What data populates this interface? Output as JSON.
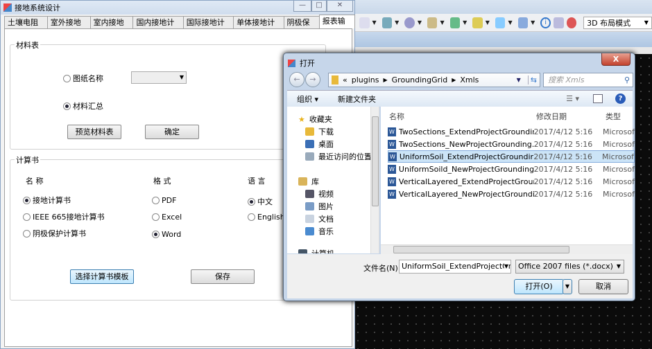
{
  "main": {
    "title": "接地系统设计",
    "tabs": [
      "土壤电阻率",
      "室外接地网",
      "室内接地网",
      "国内接地计算",
      "国际接地计算",
      "单体接地计算",
      "阴极保护",
      "报表输出"
    ],
    "materials": {
      "legend": "材料表",
      "drawing_name_label": "图纸名称",
      "drawing_name_value": "",
      "summary_label": "材料汇总",
      "preview_button": "预览材料表",
      "confirm_button": "确定"
    },
    "calc": {
      "legend": "计算书",
      "name_header": "名  称",
      "format_header": "格  式",
      "language_header": "语  言",
      "names": [
        {
          "label": "接地计算书",
          "checked": true
        },
        {
          "label": "IEEE 665接地计算书",
          "checked": false
        },
        {
          "label": "阴极保护计算书",
          "checked": false
        }
      ],
      "formats": [
        {
          "label": "PDF",
          "checked": false
        },
        {
          "label": "Excel",
          "checked": false
        },
        {
          "label": "Word",
          "checked": true
        }
      ],
      "languages": [
        {
          "label": "中文",
          "checked": true
        },
        {
          "label": "English",
          "checked": false
        }
      ],
      "template_button": "选择计算书模板",
      "save_button": "保存"
    }
  },
  "toolbar": {
    "layout_mode": "3D 布局模式"
  },
  "dialog": {
    "title": "打开",
    "close": "X",
    "path": [
      "«",
      "plugins",
      "GroundingGrid",
      "Xmls"
    ],
    "search_placeholder": "搜索 Xmls",
    "organize": "组织 ▾",
    "new_folder": "新建文件夹",
    "nav": [
      "收藏夹",
      "下载",
      "桌面",
      "最近访问的位置",
      "库",
      "视频",
      "图片",
      "文档",
      "音乐",
      "计算机"
    ],
    "columns": [
      "名称",
      "修改日期",
      "类型"
    ],
    "files": [
      {
        "name": "TwoSections_ExtendProjectGroundin...",
        "date": "2017/4/12 5:16",
        "type": "Microsof"
      },
      {
        "name": "TwoSections_NewProjectGrounding...",
        "date": "2017/4/12 5:16",
        "type": "Microsof"
      },
      {
        "name": "UniformSoil_ExtendProjectGroundin...",
        "date": "2017/4/12 5:16",
        "type": "Microsof",
        "selected": true
      },
      {
        "name": "UniformSoild_NewProjectGrounding...",
        "date": "2017/4/12 5:16",
        "type": "Microsof"
      },
      {
        "name": "VerticalLayered_ExtendProjectGroun...",
        "date": "2017/4/12 5:16",
        "type": "Microsof"
      },
      {
        "name": "VerticalLayered_NewProjectGroundi...",
        "date": "2017/4/12 5:16",
        "type": "Microsof"
      }
    ],
    "filename_label": "文件名(N):",
    "filename_value": "UniformSoil_ExtendProjectGrc",
    "filetype": "Office 2007 files (*.docx)",
    "open_button": "打开(O)",
    "cancel_button": "取消"
  }
}
